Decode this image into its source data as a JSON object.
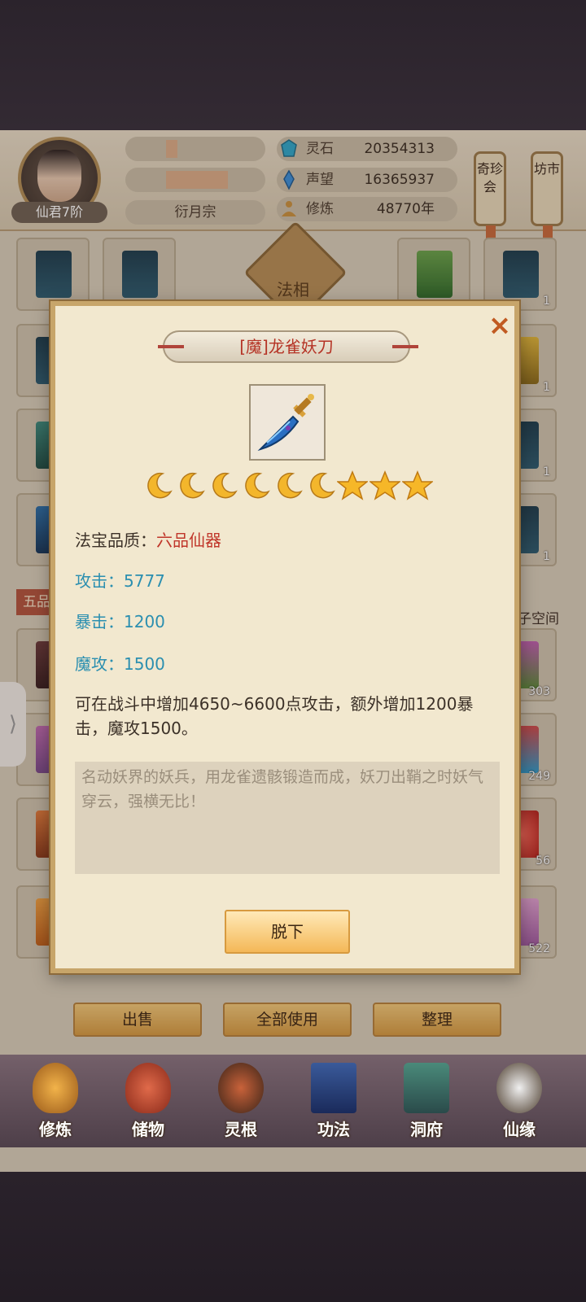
{
  "player": {
    "rank": "仙君7阶",
    "sect": "衍月宗"
  },
  "resources": [
    {
      "label": "灵石",
      "value": "20354313",
      "icon": "spirit-stone-icon"
    },
    {
      "label": "声望",
      "value": "16365937",
      "icon": "reputation-icon"
    },
    {
      "label": "修炼",
      "value": "48770年",
      "icon": "cultivation-icon"
    }
  ],
  "side_tabs": [
    {
      "label": "奇珍会"
    },
    {
      "label": "坊市"
    }
  ],
  "inventory": {
    "center_badge": "法相",
    "section_tag": "五品",
    "space_label": "子空间",
    "counts": [
      "1",
      "1",
      "1",
      "1",
      "1",
      "1",
      "303",
      "249",
      "56",
      "522"
    ]
  },
  "actions": {
    "sell": "出售",
    "use_all": "全部使用",
    "sort": "整理"
  },
  "nav": [
    {
      "label": "修炼",
      "icon": "cultivation-nav-icon"
    },
    {
      "label": "储物",
      "icon": "storage-bag-icon"
    },
    {
      "label": "灵根",
      "icon": "spirit-root-icon"
    },
    {
      "label": "功法",
      "icon": "technique-book-icon"
    },
    {
      "label": "洞府",
      "icon": "cave-house-icon"
    },
    {
      "label": "仙缘",
      "icon": "immortal-fate-icon"
    }
  ],
  "item_modal": {
    "title": "[魔]龙雀妖刀",
    "stars": {
      "moons": 6,
      "stars": 3
    },
    "quality_label": "法宝品质：",
    "quality_value": "六品仙器",
    "stats": [
      {
        "text": "攻击：5777"
      },
      {
        "text": "暴击：1200"
      },
      {
        "text": "魔攻：1500"
      }
    ],
    "effect": "可在战斗中增加4650~6600点攻击，额外增加1200暴击，魔攻1500。",
    "description": "名动妖界的妖兵，用龙雀遗骸锻造而成，妖刀出鞘之时妖气穿云，强横无比！",
    "unequip_button": "脱下",
    "close_symbol": "×"
  },
  "colors": {
    "title_red": "#b53325",
    "stat_blue": "#2b8fb0",
    "quality_red": "#c0362a"
  }
}
